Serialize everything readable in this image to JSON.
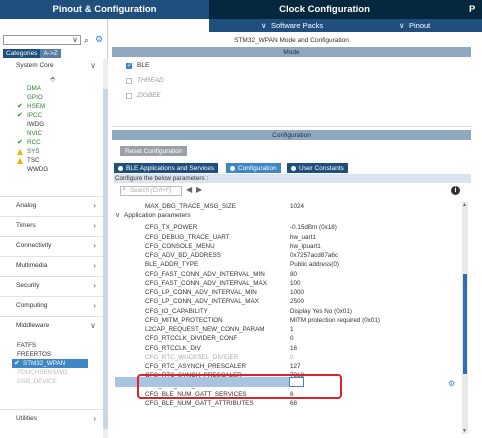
{
  "tabs": {
    "pinout": "Pinout & Configuration",
    "clock": "Clock Configuration",
    "p": "P"
  },
  "subbar": {
    "software_packs": "Software Packs",
    "pinout": "Pinout"
  },
  "left_panel": {
    "categories_tab": "Categories",
    "az_tab": "A->Z",
    "system_core": "System Core",
    "system_core_items": [
      {
        "label": "DMA",
        "state": "none"
      },
      {
        "label": "GPIO",
        "state": "none"
      },
      {
        "label": "HSEM",
        "state": "ok"
      },
      {
        "label": "IPCC",
        "state": "ok"
      },
      {
        "label": "IWDG",
        "state": "none"
      },
      {
        "label": "NVIC",
        "state": "none"
      },
      {
        "label": "RCC",
        "state": "ok"
      },
      {
        "label": "SYS",
        "state": "warn"
      },
      {
        "label": "TSC",
        "state": "warn"
      },
      {
        "label": "WWDG",
        "state": "none"
      }
    ],
    "groups": [
      "Analog",
      "Timers",
      "Connectivity",
      "Multimedia",
      "Security",
      "Computing",
      "Middleware",
      "Utilities"
    ],
    "middleware_items": [
      {
        "label": "FATFS",
        "state": "none"
      },
      {
        "label": "FREERTOS",
        "state": "none"
      },
      {
        "label": "STM32_WPAN",
        "state": "selected"
      },
      {
        "label": "TOUCHSENSING",
        "state": "disabled"
      },
      {
        "label": "USB_DEVICE",
        "state": "disabled"
      }
    ]
  },
  "mode": {
    "title": "STM32_WPAN Mode and Configuration",
    "header": "Mode",
    "options": [
      {
        "label": "BLE",
        "checked": true
      },
      {
        "label": "THREAD",
        "checked": false
      },
      {
        "label": "ZIGBEE",
        "checked": false
      }
    ]
  },
  "configuration": {
    "header": "Configuration",
    "reset_button": "Reset Configuration",
    "subtabs": [
      "BLE Applications and Services",
      "Configuration",
      "User Constants"
    ],
    "hint": "Configure the below parameters :",
    "search_placeholder": "Search (Crtl+F)",
    "group_label": "Application parameters",
    "params": [
      {
        "name": "MAX_DBG_TRACE_MSG_SIZE",
        "value": "1024"
      },
      {
        "name": "CFG_TX_POWER",
        "value": "-0.15dBm (0x18)"
      },
      {
        "name": "CFG_DEBUG_TRACE_UART",
        "value": "hw_uart1"
      },
      {
        "name": "CFG_CONSOLE_MENU",
        "value": "hw_lpuart1"
      },
      {
        "name": "CFG_ADV_BD_ADDRESS",
        "value": "0x7257acd87a6c"
      },
      {
        "name": "BLE_ADDR_TYPE",
        "value": "Public address(0)"
      },
      {
        "name": "CFG_FAST_CONN_ADV_INTERVAL_MIN",
        "value": "80"
      },
      {
        "name": "CFG_FAST_CONN_ADV_INTERVAL_MAX",
        "value": "100"
      },
      {
        "name": "CFG_LP_CONN_ADV_INTERVAL_MIN",
        "value": "1000"
      },
      {
        "name": "CFG_LP_CONN_ADV_INTERVAL_MAX",
        "value": "2500"
      },
      {
        "name": "CFG_IO_CAPABILITY",
        "value": "Display Yes No (0x01)"
      },
      {
        "name": "CFG_MITM_PROTECTION",
        "value": "MITM protection required (0x01)"
      },
      {
        "name": "L2CAP_REQUEST_NEW_CONN_PARAM",
        "value": "1"
      },
      {
        "name": "CFG_RTCCLK_DIVIDER_CONF",
        "value": "0"
      },
      {
        "name": "CFG_RTCCLK_DIV",
        "value": "16"
      },
      {
        "name": "CFG_RTC_WUCKSEL_DIVIDER",
        "value": "0"
      },
      {
        "name": "CFG_RTC_ASYNCH_PRESCALER",
        "value": "127"
      },
      {
        "name": "CFG_RTC_SYNCH_PRESCALER",
        "value": "7812"
      },
      {
        "name": "CFG_BLE_NUM_LINK",
        "value": "2"
      },
      {
        "name": "CFG_BLE_NUM_GATT_SERVICES",
        "value": "8"
      },
      {
        "name": "CFG_BLE_NUM_GATT_ATTRIBUTES",
        "value": "68"
      }
    ]
  },
  "colors": {
    "tab_dark": "#06283f",
    "tab_blue": "#1f4f7d",
    "highlight_red": "#d9232d",
    "ok_green": "#2e7d32",
    "warn_yellow": "#e8b400"
  }
}
